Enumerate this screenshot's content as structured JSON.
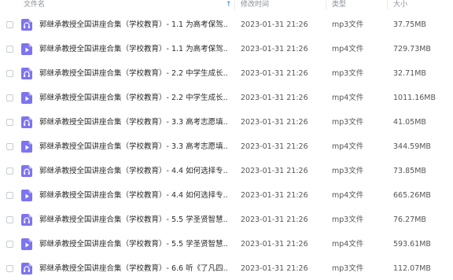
{
  "header": {
    "name": "文件名",
    "time": "修改时间",
    "type": "类型",
    "size": "大小"
  },
  "colors": {
    "icon": "#7c74f0",
    "sort_arrow": "#2f7de1"
  },
  "files": [
    {
      "name": "郭继承教授全国讲座合集（学校教育）- 1.1 为高考保驾...",
      "time": "2023-01-31 21:26",
      "type": "mp3文件",
      "size": "37.75MB",
      "icon": "audio-file-icon"
    },
    {
      "name": "郭继承教授全国讲座合集（学校教育）- 1.1 为高考保驾...",
      "time": "2023-01-31 21:26",
      "type": "mp4文件",
      "size": "729.73MB",
      "icon": "video-file-icon"
    },
    {
      "name": "郭继承教授全国讲座合集（学校教育）- 2.2 中学生成长...",
      "time": "2023-01-31 21:26",
      "type": "mp3文件",
      "size": "32.71MB",
      "icon": "audio-file-icon"
    },
    {
      "name": "郭继承教授全国讲座合集（学校教育）- 2.2 中学生成长...",
      "time": "2023-01-31 21:26",
      "type": "mp4文件",
      "size": "1011.16MB",
      "icon": "video-file-icon"
    },
    {
      "name": "郭继承教授全国讲座合集（学校教育）- 3.3 高考志愿填...",
      "time": "2023-01-31 21:26",
      "type": "mp3文件",
      "size": "41.05MB",
      "icon": "audio-file-icon"
    },
    {
      "name": "郭继承教授全国讲座合集（学校教育）- 3.3 高考志愿填...",
      "time": "2023-01-31 21:26",
      "type": "mp4文件",
      "size": "344.59MB",
      "icon": "video-file-icon"
    },
    {
      "name": "郭继承教授全国讲座合集（学校教育）- 4.4 如何选择专...",
      "time": "2023-01-31 21:26",
      "type": "mp3文件",
      "size": "73.85MB",
      "icon": "audio-file-icon"
    },
    {
      "name": "郭继承教授全国讲座合集（学校教育）- 4.4 如何选择专...",
      "time": "2023-01-31 21:26",
      "type": "mp4文件",
      "size": "665.26MB",
      "icon": "video-file-icon"
    },
    {
      "name": "郭继承教授全国讲座合集（学校教育）- 5.5 学圣贤智慧...",
      "time": "2023-01-31 21:26",
      "type": "mp3文件",
      "size": "76.27MB",
      "icon": "audio-file-icon"
    },
    {
      "name": "郭继承教授全国讲座合集（学校教育）- 5.5 学圣贤智慧...",
      "time": "2023-01-31 21:26",
      "type": "mp4文件",
      "size": "593.61MB",
      "icon": "video-file-icon"
    },
    {
      "name": "郭继承教授全国讲座合集（学校教育）- 6.6 听《了凡四...",
      "time": "2023-01-31 21:26",
      "type": "mp3文件",
      "size": "112.07MB",
      "icon": "audio-file-icon"
    }
  ]
}
